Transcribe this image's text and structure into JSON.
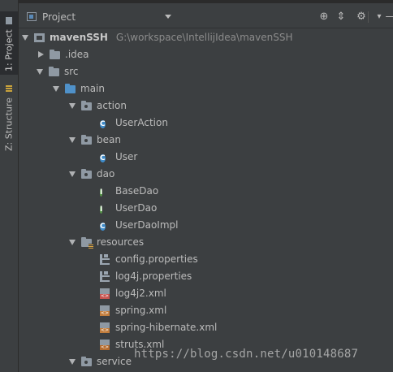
{
  "tool_window": {
    "tabs": [
      {
        "label": "1: Project",
        "active": true
      },
      {
        "label": "Z: Structure",
        "active": false
      }
    ],
    "view_selector": "Project",
    "buttons": [
      "locate-icon",
      "collapse-all-icon",
      "settings-icon",
      "hide-icon"
    ]
  },
  "tree": {
    "root": {
      "label": "mavenSSH",
      "path": "G:\\workspace\\IntellijIdea\\mavenSSH"
    },
    "items": [
      {
        "label": "mavenSSH"
      },
      {
        "label": ".idea"
      },
      {
        "label": "src"
      },
      {
        "label": "main"
      },
      {
        "label": "action"
      },
      {
        "label": "UserAction",
        "icon_letter": "C"
      },
      {
        "label": "bean"
      },
      {
        "label": "User",
        "icon_letter": "C"
      },
      {
        "label": "dao"
      },
      {
        "label": "BaseDao",
        "icon_letter": "I"
      },
      {
        "label": "UserDao",
        "icon_letter": "I"
      },
      {
        "label": "UserDaoImpl",
        "icon_letter": "C"
      },
      {
        "label": "resources"
      },
      {
        "label": "config.properties"
      },
      {
        "label": "log4j.properties"
      },
      {
        "label": "log4j2.xml",
        "icon_tag": "<>"
      },
      {
        "label": "spring.xml",
        "icon_tag": "<>"
      },
      {
        "label": "spring-hibernate.xml",
        "icon_tag": "<>"
      },
      {
        "label": "struts.xml",
        "icon_tag": "<>"
      },
      {
        "label": "service"
      }
    ]
  },
  "watermark": "https://blog.csdn.net/u010148687",
  "colors": {
    "background": "#3c3f41",
    "class_icon": "#3f8bc8",
    "interface_icon": "#5aa04a",
    "source_folder": "#4f91c9"
  }
}
